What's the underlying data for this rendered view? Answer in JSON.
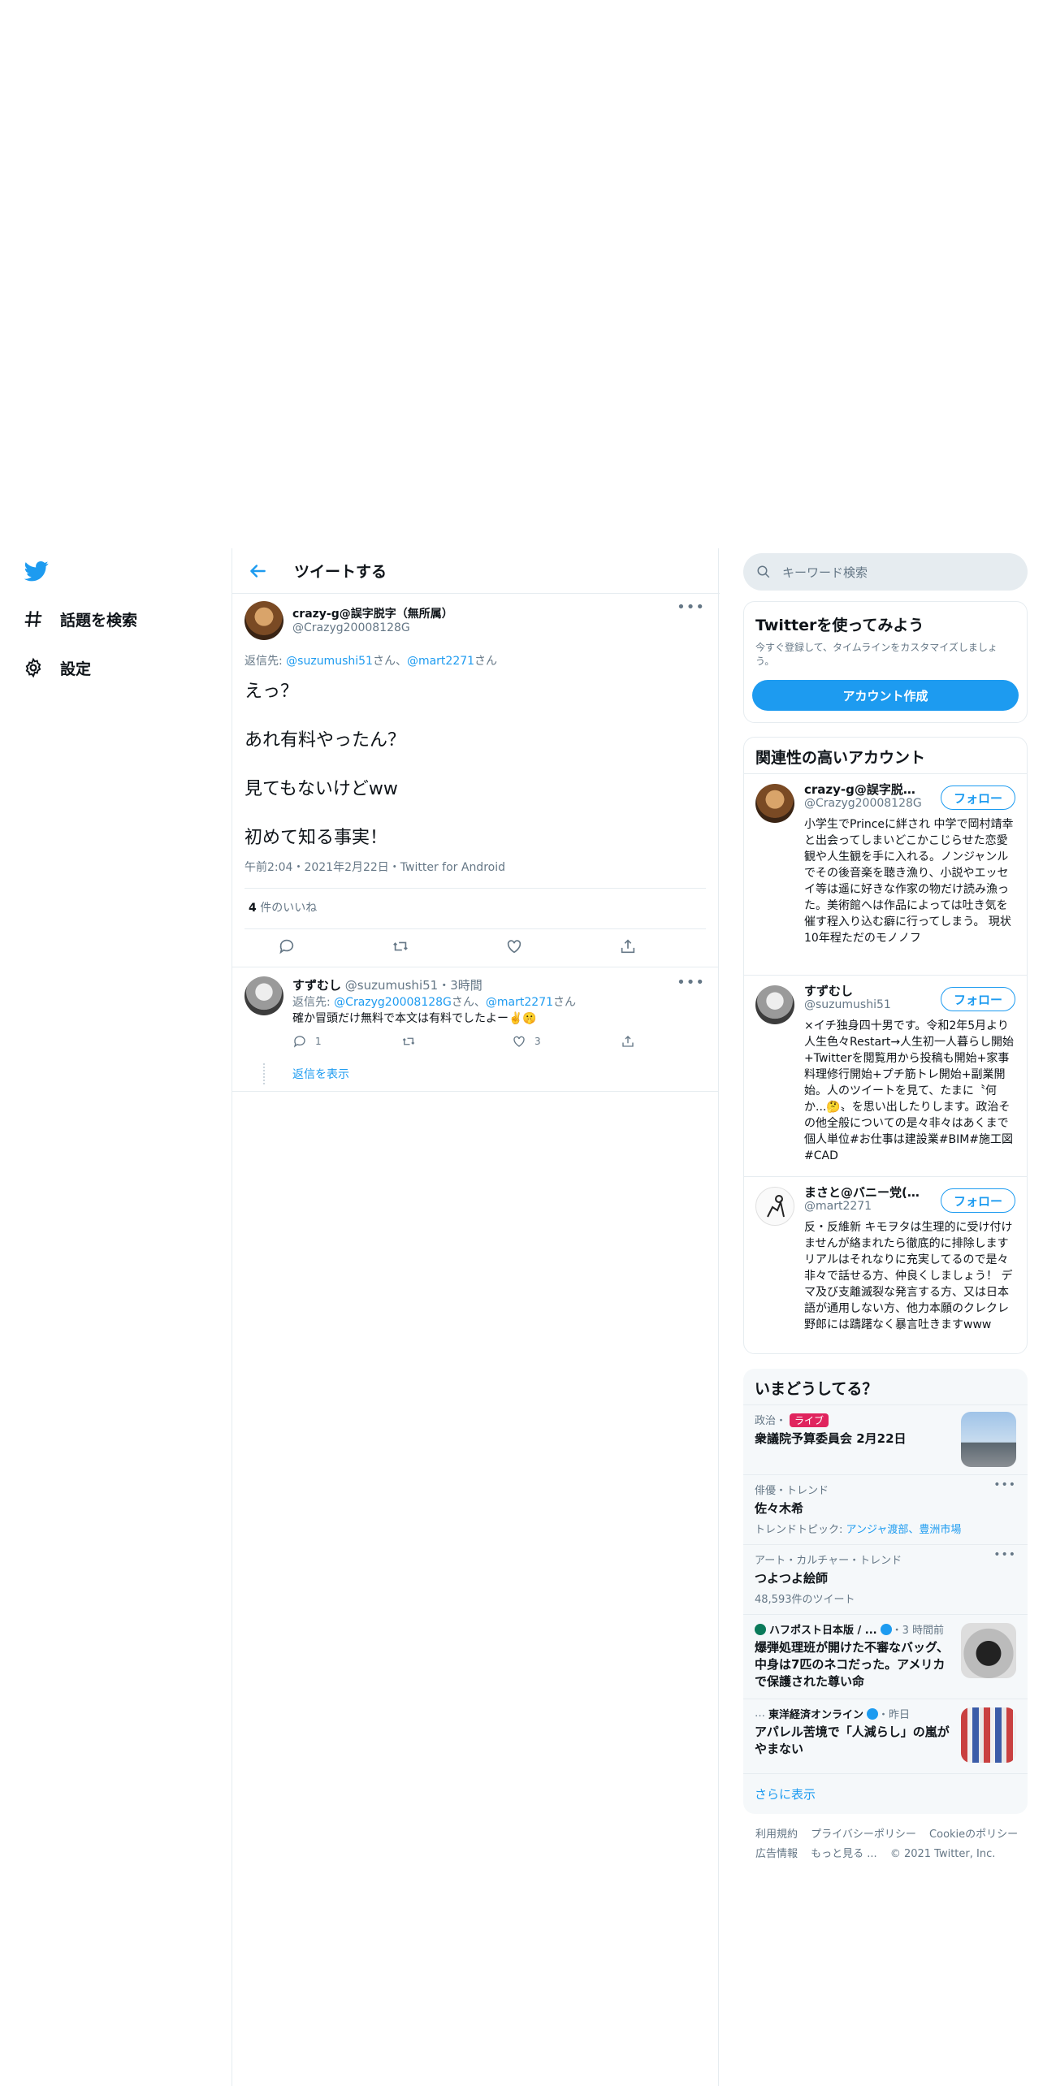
{
  "sidebar": {
    "items": [
      {
        "label": "話題を検索",
        "icon": "hashtag-icon"
      },
      {
        "label": "設定",
        "icon": "gear-icon"
      }
    ]
  },
  "header": {
    "title": "ツイートする"
  },
  "main_tweet": {
    "name": "crazy-g@誤字脱字（無所属）",
    "handle": "@Crazyg20008128G",
    "reply_prefix": "返信先:",
    "reply_to_1": "@suzumushi51",
    "reply_sep": "さん、",
    "reply_to_2": "@mart2271",
    "reply_suffix": "さん",
    "lines": [
      "えっ？",
      "あれ有料やったん？",
      "見てもないけどww",
      "初めて知る事実！"
    ],
    "meta": "午前2:04・2021年2月22日・Twitter for Android",
    "likes_count": "4",
    "likes_label": " 件のいいね"
  },
  "reply_tweet": {
    "name": "すずむし",
    "handle": "@suzumushi51",
    "time": "・3時間",
    "reply_prefix": "返信先:",
    "reply_to_1": "@Crazyg20008128G",
    "reply_sep": "さん、",
    "reply_to_2": "@mart2271",
    "reply_suffix": "さん",
    "text": "確か冒頭だけ無料で本文は有料でしたよー✌️🤫",
    "reply_count": "1",
    "like_count": "3",
    "show_replies": "返信を表示"
  },
  "search": {
    "placeholder": "キーワード検索"
  },
  "signup": {
    "title": "Twitterを使ってみよう",
    "desc": "今すぐ登録して、タイムラインをカスタマイズしましょう。",
    "button": "アカウント作成"
  },
  "who_to_follow": {
    "title": "関連性の高いアカウント",
    "follow_label": "フォロー",
    "accounts": [
      {
        "name": "crazy-g@誤字脱字（無所属）",
        "handle": "@Crazyg20008128G",
        "bio": "小学生でPrinceに絆され 中学で岡村靖幸と出会ってしまいどこかこじらせた恋愛観や人生観を手に入れる。ノンジャンルでその後音楽を聴き漁り、小説やエッセイ等は遥に好きな作家の物だけ読み漁った。美術館へは作品によっては吐き気を催す程入り込む癖に行ってしまう。 現状10年程ただのモノノフ"
      },
      {
        "name": "すずむし",
        "handle": "@suzumushi51",
        "bio": "×イチ独身四十男です。令和2年5月より人生色々Restart→人生初一人暮らし開始+Twitterを閲覧用から投稿も開始+家事料理修行開始+プチ筋トレ開始+副業開始。人のツイートを見て、たまに〝何か...🤔〟を思い出したりします。政治その他全般についての是々非々はあくまで個人単位#お仕事は建設業#BIM#施工図#CAD"
      },
      {
        "name": "まさと@バニー党(し…",
        "handle": "@mart2271",
        "bio": "反・反維新 キモヲタは生理的に受け付けませんが絡まれたら徹底的に排除します リアルはそれなりに充実してるので是々非々で話せる方、仲良くしましょう！ デマ及び支離滅裂な発言する方、又は日本語が通用しない方、他力本願のクレクレ野郎には躊躇なく暴言吐きますwww"
      }
    ]
  },
  "trends": {
    "title": "いまどうしてる？",
    "items": [
      {
        "context": "政治・",
        "badge": "ライブ",
        "title": "衆議院予算委員会 2月22日"
      },
      {
        "context": "俳優・トレンド",
        "title": "佐々木希",
        "sub_prefix": "トレンドトピック: ",
        "sub_links": "アンジャ渡部、豊洲市場"
      },
      {
        "context": "アート・カルチャー・トレンド",
        "title": "つよつよ絵師",
        "sub": "48,593件のツイート"
      },
      {
        "source": "ハフポスト日本版 / ...",
        "time": "・3 時間前",
        "title": "爆弾処理班が開けた不審なバッグ、中身は7匹のネコだった。アメリカで保護された尊い命"
      },
      {
        "source": "東洋経済オンライン",
        "time": "・昨日",
        "title": "アパレル苦境で「人減らし」の嵐がやまない"
      }
    ],
    "show_more": "さらに表示"
  },
  "footer": {
    "links": [
      "利用規約",
      "プライバシーポリシー",
      "Cookieのポリシー",
      "広告情報",
      "もっと見る ...",
      "© 2021 Twitter, Inc."
    ]
  },
  "colors": {
    "accent": "#1d9bf0",
    "live": "#e0245e",
    "muted": "#657786"
  }
}
